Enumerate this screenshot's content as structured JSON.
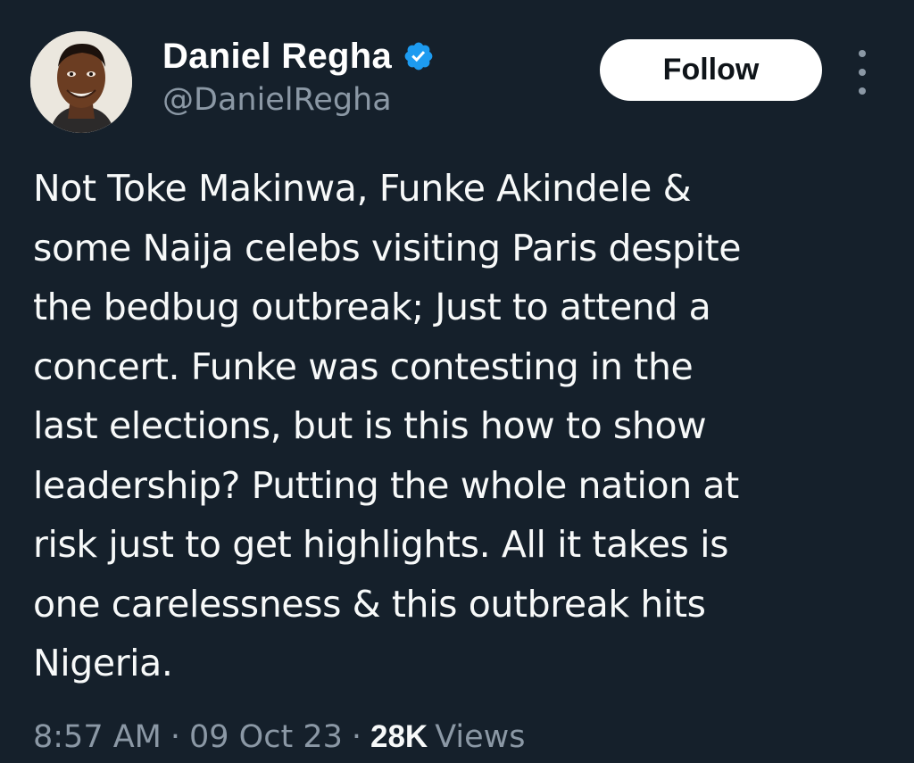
{
  "author": {
    "display_name": "Daniel Regha",
    "handle": "@DanielRegha",
    "verified": true,
    "avatar_icon": "profile-photo"
  },
  "actions": {
    "follow_label": "Follow",
    "more_icon": "more-vertical-icon"
  },
  "tweet": {
    "text": "Not Toke Makinwa, Funke Akindele &\nsome Naija celebs visiting Paris despite\nthe bedbug outbreak; Just to attend a\nconcert. Funke was contesting in the\nlast elections, but is this how to show\nleadership? Putting the whole nation at\nrisk just to get highlights. All it takes is\none carelessness & this outbreak hits\nNigeria."
  },
  "meta": {
    "time": "8:57 AM",
    "separator": "·",
    "date": "09 Oct 23",
    "views_count": "28K",
    "views_label": "Views"
  },
  "colors": {
    "background": "#15202b",
    "verified_badge": "#1d9bf0",
    "secondary_text": "#8b98a5",
    "follow_button_bg": "#ffffff"
  }
}
